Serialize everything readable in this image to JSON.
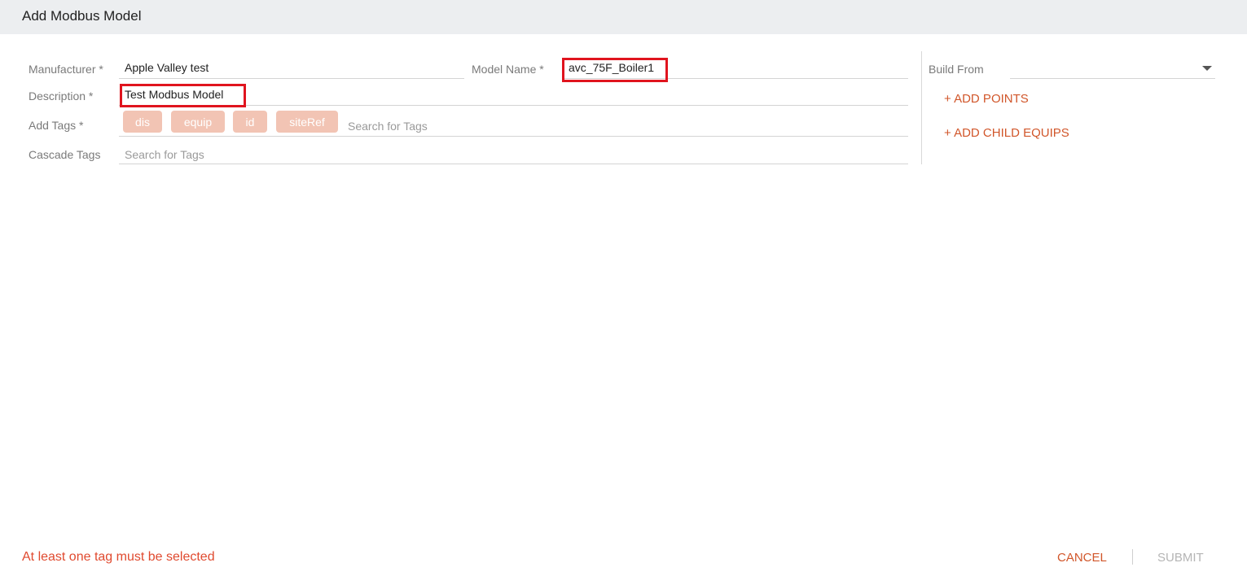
{
  "header": {
    "title": "Add Modbus Model"
  },
  "form": {
    "manufacturer": {
      "label": "Manufacturer *",
      "value": "Apple Valley test"
    },
    "model_name": {
      "label": "Model Name *",
      "value": "avc_75F_Boiler1"
    },
    "description": {
      "label": "Description *",
      "value": "Test Modbus Model"
    },
    "add_tags": {
      "label": "Add Tags *",
      "tags": [
        "dis",
        "equip",
        "id",
        "siteRef"
      ],
      "placeholder": "Search for Tags"
    },
    "cascade_tags": {
      "label": "Cascade Tags",
      "placeholder": "Search for Tags"
    }
  },
  "side": {
    "build_from": {
      "label": "Build From",
      "value": ""
    },
    "add_points": "+ ADD POINTS",
    "add_child_equips": "+ ADD CHILD EQUIPS"
  },
  "footer": {
    "error": "At least one tag must be selected",
    "cancel": "CANCEL",
    "submit": "SUBMIT"
  },
  "colors": {
    "accent": "#d1562a",
    "chip": "#f2c4b4",
    "error": "#e04a2f",
    "highlight": "#e0141e",
    "disabled": "#b5b5b5"
  }
}
